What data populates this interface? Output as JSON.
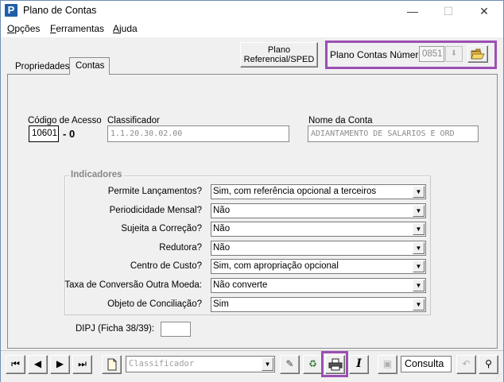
{
  "window": {
    "title": "Plano de Contas",
    "minimize": "—",
    "maximize": "☐",
    "close": "✕",
    "app_icon": "P"
  },
  "menu": [
    {
      "label": "Opções",
      "ul": "O",
      "rest": "pções"
    },
    {
      "label": "Ferramentas",
      "ul": "F",
      "rest": "erramentas"
    },
    {
      "label": "Ajuda",
      "ul": "A",
      "rest": "juda"
    }
  ],
  "header": {
    "plano_ref_line1": "Plano",
    "plano_ref_line2": "Referencial/SPED",
    "plano_contas_label": "Plano Contas Número",
    "plano_contas_value": "0851",
    "highlight_color": "#9b4fb3"
  },
  "tabs": [
    {
      "label": "Propriedades",
      "active": false
    },
    {
      "label": "Contas",
      "active": true
    }
  ],
  "conta": {
    "codigo_label": "Código de Acesso",
    "codigo_value": "10601",
    "codigo_suffix": "- 0",
    "classificador_label": "Classificador",
    "classificador_value": "1.1.20.30.02.00",
    "nome_label": "Nome da Conta",
    "nome_value": "ADIANTAMENTO DE SALARIOS E ORD"
  },
  "indicadores": {
    "title": "Indicadores",
    "rows": [
      {
        "label": "Permite Lançamentos?",
        "value": "Sim, com referência opcional a terceiros"
      },
      {
        "label": "Periodicidade Mensal?",
        "value": "Não"
      },
      {
        "label": "Sujeita a Correção?",
        "value": "Não"
      },
      {
        "label": "Redutora?",
        "value": "Não"
      },
      {
        "label": "Centro de Custo?",
        "value": "Sim, com apropriação opcional"
      },
      {
        "label": "Taxa de Conversão Outra Moeda:",
        "value": "Não converte"
      },
      {
        "label": "Objeto de Conciliação?",
        "value": "Sim"
      }
    ]
  },
  "dipj": {
    "label": "DIPJ (Ficha 38/39):",
    "value": ""
  },
  "toolbar": {
    "classificador_placeholder": "Classificador",
    "mode": "Consulta"
  }
}
